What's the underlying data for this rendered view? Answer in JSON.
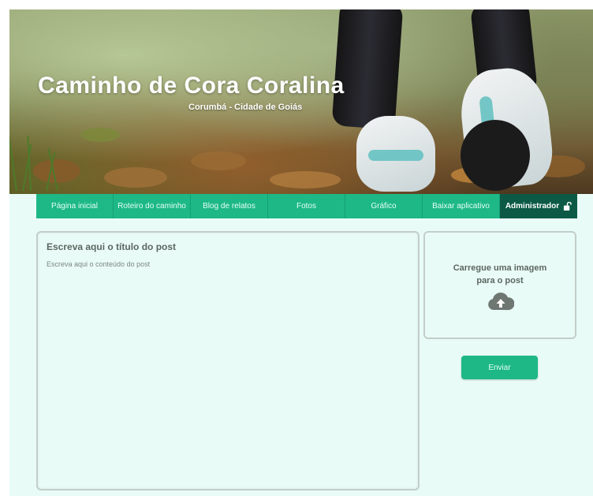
{
  "header": {
    "title": "Caminho de Cora Coralina",
    "subtitle": "Corumbá - Cidade de Goiás"
  },
  "nav": {
    "items": [
      {
        "label": "Página inicial"
      },
      {
        "label": "Roteiro do caminho"
      },
      {
        "label": "Blog de relatos"
      },
      {
        "label": "Fotos"
      },
      {
        "label": "Gráfico"
      },
      {
        "label": "Baixar aplicativo"
      },
      {
        "label": "Administrador",
        "icon": "lock-open-icon"
      }
    ]
  },
  "editor": {
    "title_placeholder": "Escreva aqui o título do post",
    "content_placeholder": "Escreva aqui o conteúdo do post"
  },
  "upload": {
    "line1": "Carregue uma imagem",
    "line2": "para o post",
    "icon": "cloud-upload-icon"
  },
  "actions": {
    "send_label": "Enviar"
  },
  "colors": {
    "nav_green": "#1db886",
    "nav_admin": "#0c5a45",
    "page_bg": "#e9fbf6",
    "text_gray": "#5c6661"
  }
}
